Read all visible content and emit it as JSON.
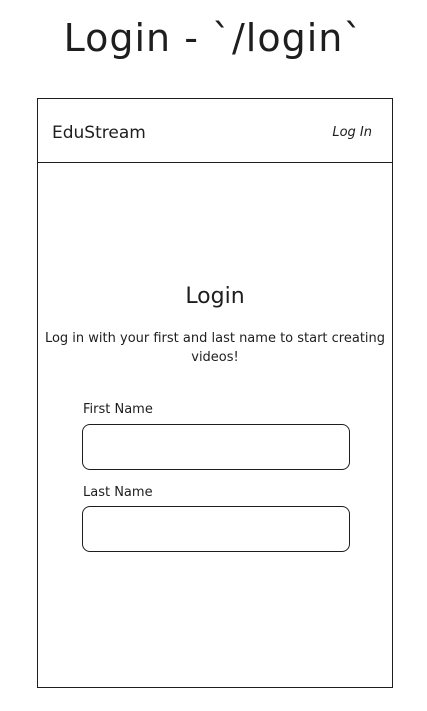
{
  "title": "Login - `/login`",
  "nav": {
    "brand": "EduStream",
    "login": "Log In"
  },
  "main": {
    "heading": "Login",
    "subtitle": "Log in with your first and last name to start creating videos!",
    "first_name_label": "First Name",
    "last_name_label": "Last Name",
    "first_name_value": "",
    "last_name_value": ""
  }
}
